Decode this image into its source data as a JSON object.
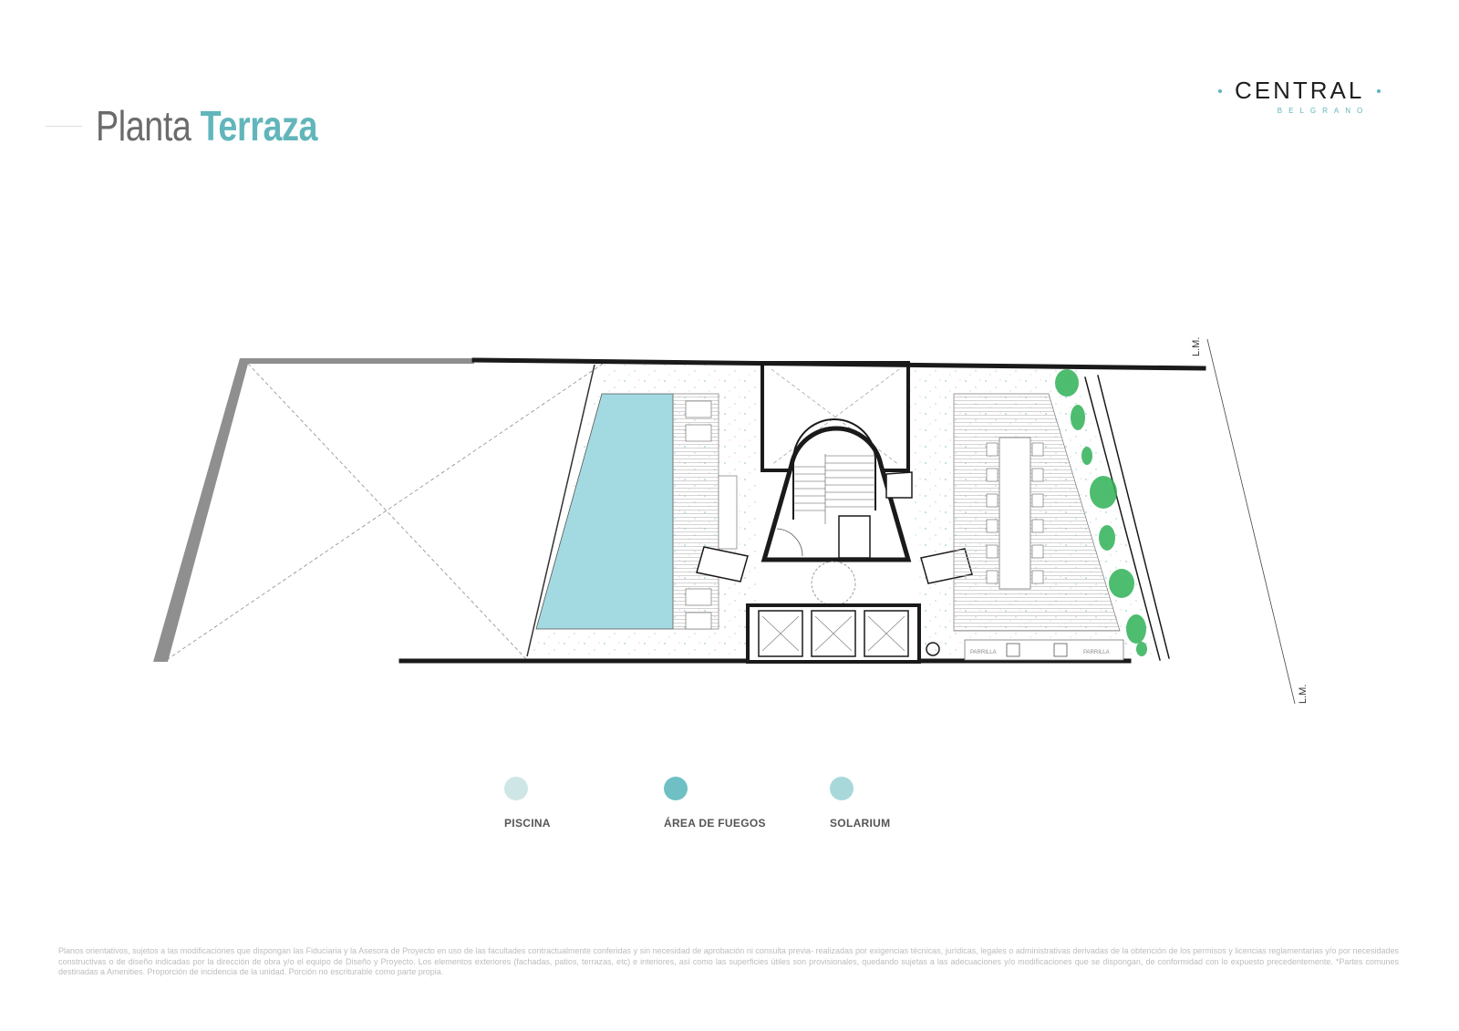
{
  "title": {
    "word1": "Planta",
    "word2": "Terraza"
  },
  "logo": {
    "main": "CENTRAL",
    "sub": "BELGRANO"
  },
  "plan_labels": {
    "lm_top": "L.M.",
    "lm_bottom": "L.M.",
    "parrilla_left": "PARRILLA",
    "parrilla_right": "PARRILLA"
  },
  "legend": [
    {
      "label": "PISCINA",
      "color": "#cfe6e6"
    },
    {
      "label": "ÁREA DE FUEGOS",
      "color": "#6fc0c5"
    },
    {
      "label": "SOLARIUM",
      "color": "#a9d8db"
    }
  ],
  "colors": {
    "pool": "#a3dae2",
    "wall": "#1a1a1a",
    "greenery": "#2fb257",
    "accent": "#62b6bb"
  },
  "disclaimer": "Planos orientativos, sujetos a las modificaciones que dispongan las Fiduciaria y la Asesora de Proyecto en uso de las facultades contractualmente conferidas y sin necesidad de aprobación ni consulta previa- realizadas por exigencias técnicas, jurídicas, legales o administrativas derivadas de la obtención de los permisos y licencias reglamentarias y/o por necesidades constructivas o de diseño indicadas por la dirección de obra y/o el equipo de Diseño y Proyecto. Los elementos exteriores (fachadas, patios, terrazas, etc) e interiores, así como las superficies útiles son provisionales, quedando sujetas a las adecuaciones y/o modificaciones que se dispongan, de conformidad con lo expuesto precedentemente. *Partes comunes destinadas a Amenities. Proporción de incidencia de la unidad. Porción no escriturable como parte propia."
}
